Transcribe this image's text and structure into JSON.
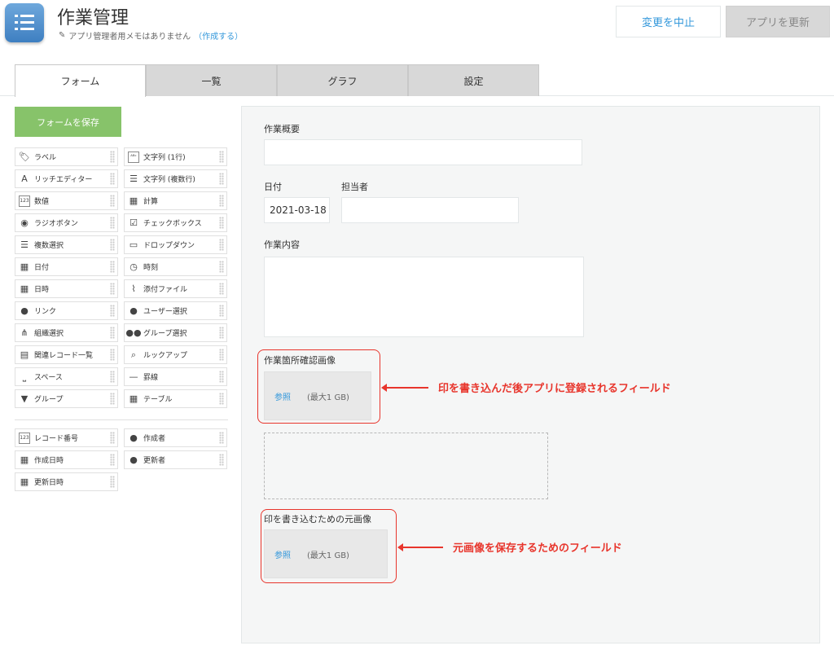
{
  "header": {
    "title": "作業管理",
    "memo_text": "アプリ管理者用メモはありません",
    "memo_link": "（作成する）",
    "cancel_label": "変更を中止",
    "update_label": "アプリを更新"
  },
  "tabs": [
    {
      "label": "フォーム"
    },
    {
      "label": "一覧"
    },
    {
      "label": "グラフ"
    },
    {
      "label": "設定"
    }
  ],
  "palette": {
    "save_label": "フォームを保存",
    "items": [
      {
        "label": "ラベル",
        "icon": "tag-icon"
      },
      {
        "label": "文字列 (1行)",
        "icon": "abc-icon"
      },
      {
        "label": "リッチエディター",
        "icon": "rich-editor-icon"
      },
      {
        "label": "文字列 (複数行)",
        "icon": "multiline-text-icon"
      },
      {
        "label": "数値",
        "icon": "number-icon"
      },
      {
        "label": "計算",
        "icon": "calculator-icon"
      },
      {
        "label": "ラジオボタン",
        "icon": "radio-icon"
      },
      {
        "label": "チェックボックス",
        "icon": "checkbox-icon"
      },
      {
        "label": "複数選択",
        "icon": "multi-select-icon"
      },
      {
        "label": "ドロップダウン",
        "icon": "dropdown-icon"
      },
      {
        "label": "日付",
        "icon": "date-icon"
      },
      {
        "label": "時刻",
        "icon": "clock-icon"
      },
      {
        "label": "日時",
        "icon": "datetime-icon"
      },
      {
        "label": "添付ファイル",
        "icon": "paperclip-icon"
      },
      {
        "label": "リンク",
        "icon": "globe-icon"
      },
      {
        "label": "ユーザー選択",
        "icon": "user-icon"
      },
      {
        "label": "組織選択",
        "icon": "org-icon"
      },
      {
        "label": "グループ選択",
        "icon": "group-icon"
      },
      {
        "label": "関連レコード一覧",
        "icon": "related-records-icon"
      },
      {
        "label": "ルックアップ",
        "icon": "lookup-icon"
      },
      {
        "label": "スペース",
        "icon": "space-icon"
      },
      {
        "label": "罫線",
        "icon": "rule-line-icon"
      },
      {
        "label": "グループ",
        "icon": "group-folder-icon"
      },
      {
        "label": "テーブル",
        "icon": "table-icon"
      }
    ],
    "system_items": [
      {
        "label": "レコード番号",
        "icon": "number-icon"
      },
      {
        "label": "作成者",
        "icon": "user-icon"
      },
      {
        "label": "作成日時",
        "icon": "datetime-icon"
      },
      {
        "label": "更新者",
        "icon": "user-icon"
      },
      {
        "label": "更新日時",
        "icon": "datetime-icon"
      }
    ]
  },
  "form": {
    "summary_label": "作業概要",
    "date_label": "日付",
    "date_value": "2021-03-18",
    "assignee_label": "担当者",
    "content_label": "作業内容",
    "image1_label": "作業箇所確認画像",
    "image2_label": "印を書き込むための元画像",
    "browse_label": "参照",
    "limit_label": "(最大1 GB)"
  },
  "annotations": {
    "note1": "印を書き込んだ後アプリに登録されるフィールド",
    "note2": "元画像を保存するためのフィールド",
    "color": "#e8352c"
  }
}
